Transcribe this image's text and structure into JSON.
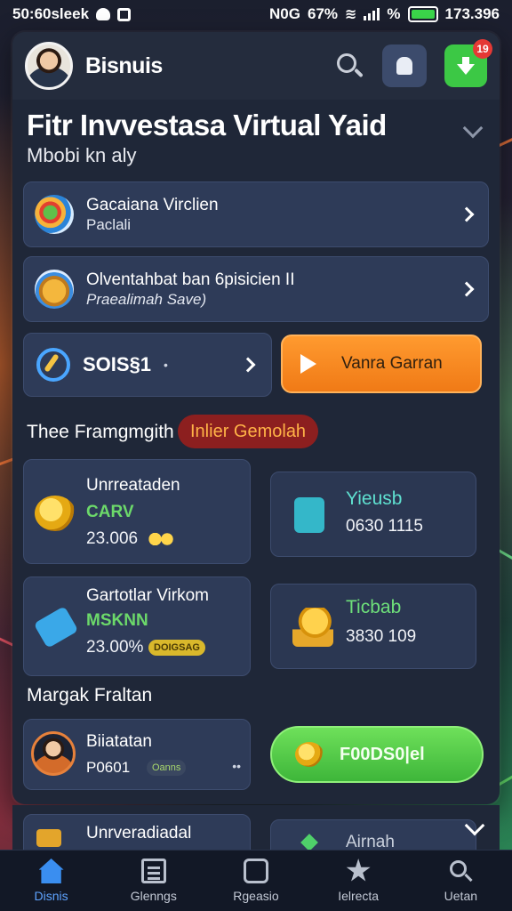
{
  "status_bar": {
    "time": "50:60sleek",
    "network": "N0G",
    "signal_pct": "67%",
    "extra": "%",
    "clock": "173.396"
  },
  "header": {
    "brand": "Bisnuis",
    "notification_count": "19"
  },
  "hero": {
    "title": "Fitr Invvestasa Virtual Yaid",
    "subtitle": "Mbobi kn aly"
  },
  "list_cards": [
    {
      "title": "Gacaiana Virclien",
      "subtitle": "Paclali",
      "icon": "salad-icon"
    },
    {
      "title": "Olventahbat ban 6pisicien II",
      "subtitle": "Praealimah Save)",
      "icon": "basket-icon"
    }
  ],
  "actions": {
    "left_label": "SOIS§1",
    "left_extra": "•",
    "primary_label": "Vanra Garran"
  },
  "section_programs": {
    "title": "Thee Framgmgith",
    "pill": "Inlier Gemolah"
  },
  "stat_cards": [
    {
      "title": "Unrreataden",
      "tag": "CARV",
      "value": "23.006",
      "icon": "gold-coin-icon"
    },
    {
      "title": "Yieusb",
      "value": "0630 1115",
      "icon": "clipboard-icon"
    },
    {
      "title": "Gartotlar Virkom",
      "tag": "MSKNN",
      "value": "23.00%",
      "mini_tag": "DOIGSAG",
      "icon": "chip-icon"
    },
    {
      "title": "Ticbab",
      "value": "3830 109",
      "icon": "coin-stack-icon"
    }
  ],
  "section_market": {
    "title": "Margak Fraltan"
  },
  "profile": {
    "name": "Biiatatan",
    "code": "P0601",
    "tag": "Oanns",
    "dots": "••"
  },
  "green_cta": {
    "label": "F00DS0|el"
  },
  "peek_cards": [
    {
      "title": "Unrveradiadal"
    },
    {
      "title": "Airnah"
    }
  ],
  "bottom_nav": [
    {
      "label": "Disnis",
      "icon": "home-icon",
      "active": true
    },
    {
      "label": "Glenngs",
      "icon": "document-icon",
      "active": false
    },
    {
      "label": "Rgeasio",
      "icon": "clipboard-icon",
      "active": false
    },
    {
      "label": "Ielrecta",
      "icon": "star-icon",
      "active": false
    },
    {
      "label": "Uetan",
      "icon": "search-icon",
      "active": false
    }
  ],
  "colors": {
    "accent_blue": "#5ea3ff",
    "orange_cta": "#f07a16",
    "green_cta": "#3eb63a",
    "pill_bg": "#8c1f1f",
    "pill_text": "#ffb347"
  }
}
